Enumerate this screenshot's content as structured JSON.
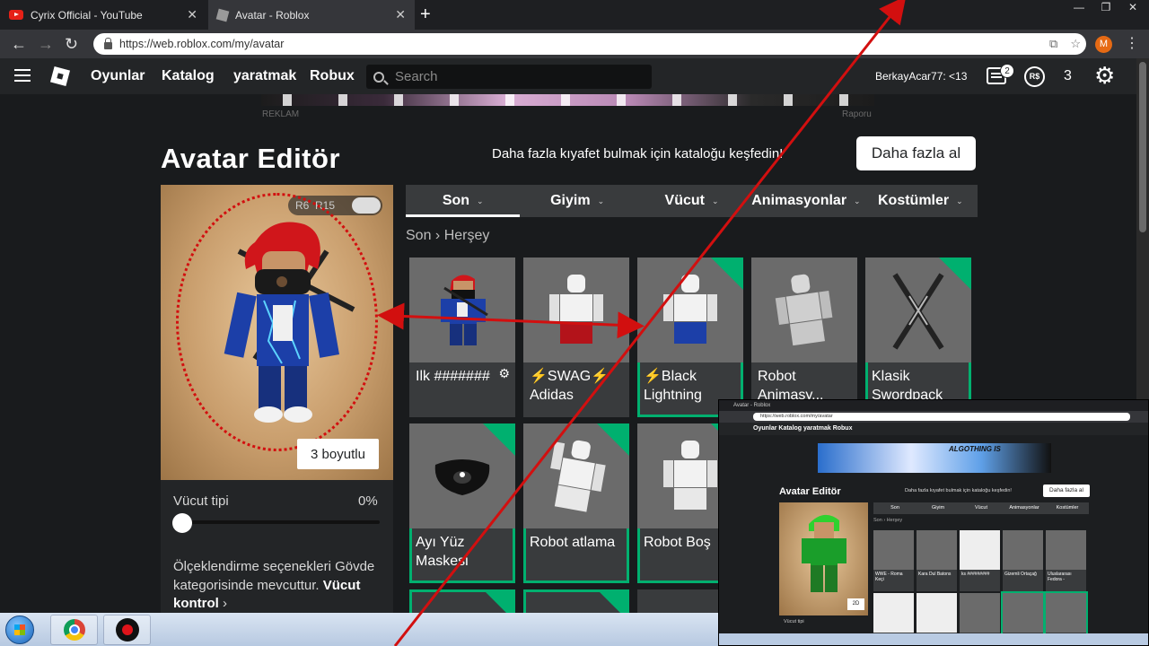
{
  "browser": {
    "tabs": [
      {
        "title": "Cyrix Official - YouTube",
        "icon": "youtube-icon"
      },
      {
        "title": "Avatar - Roblox",
        "icon": "roblox-icon"
      }
    ],
    "url": "https://web.roblox.com/my/avatar",
    "profile_initial": "M"
  },
  "header": {
    "nav": [
      "Oyunlar",
      "Katalog",
      "yaratmak",
      "Robux"
    ],
    "search_placeholder": "Search",
    "username": "BerkayAcar77: <13",
    "messages_badge": "2",
    "robux_icon_label": "R$",
    "robux_count": "3"
  },
  "ad": {
    "left_label": "REKLAM",
    "right_label": "Raporu"
  },
  "editor": {
    "title": "Avatar Editör",
    "discover_text": "Daha fazla kıyafet bulmak için kataloğu keşfedin!",
    "get_more": "Daha fazla al",
    "toggle_left": "R6",
    "toggle_right": "R15",
    "view_button": "3 boyutlu",
    "body_type_label": "Vücut tipi",
    "body_type_value": "0%",
    "scaling_note": "Ölçeklendirme seçenekleri Gövde kategorisinde mevcuttur.",
    "body_controls": "Vücut kontrol",
    "body_controls_chevron": "›"
  },
  "tabs": [
    {
      "label": "Son",
      "active": true
    },
    {
      "label": "Giyim",
      "active": false
    },
    {
      "label": "Vücut",
      "active": false
    },
    {
      "label": "Animasyonlar",
      "active": false
    },
    {
      "label": "Kostümler",
      "active": false
    }
  ],
  "tab_chevron": "⌄",
  "breadcrumb": {
    "parent": "Son",
    "separator": "›",
    "current": "Herşey"
  },
  "items": [
    {
      "name": "Ilk #######",
      "equipped": false,
      "icon": "outfit-thumbnail",
      "gear": "⚙"
    },
    {
      "name": "⚡SWAG⚡ Adidas",
      "equipped": false,
      "icon": "outfit-thumbnail"
    },
    {
      "name": "⚡Black Lightning",
      "equipped": true,
      "icon": "outfit-thumbnail"
    },
    {
      "name": "Robot Animasy...",
      "equipped": false,
      "icon": "robot-thumbnail"
    },
    {
      "name": "Klasik Swordpack",
      "equipped": true,
      "icon": "swords-thumbnail"
    },
    {
      "name": "Ayı Yüz Maskesi",
      "equipped": true,
      "icon": "mask-thumbnail"
    },
    {
      "name": "Robot atlama",
      "equipped": true,
      "icon": "robot-thumbnail"
    },
    {
      "name": "Robot Boş",
      "equipped": true,
      "icon": "robot-thumbnail"
    }
  ],
  "pip": {
    "tab_title": "Avatar - Roblox",
    "url": "https://web.roblox.com/my/avatar",
    "nav": "Oyunlar   Katalog   yaratmak   Robux",
    "banner_text": "ALGOTHING IS",
    "title": "Avatar Editör",
    "discover": "Daha fazla kıyafet bulmak için kataloğu keşfedin!",
    "get_more": "Daha fazla al",
    "tabs": [
      "Son",
      "Giyim",
      "Vücut",
      "Animasyonlar",
      "Kostümler"
    ],
    "crumb": "Son › Herşey",
    "view_button": "2D",
    "body_type": "Vücut tipi",
    "items": [
      "WWE - Roma Keçi",
      "Kara Dul Batons",
      "ks #########",
      "Gizemli Ortaçağ",
      "Uluslararası Fedora -"
    ]
  },
  "colors": {
    "accent_green": "#00b06f",
    "annotation_red": "#d20f0f"
  }
}
